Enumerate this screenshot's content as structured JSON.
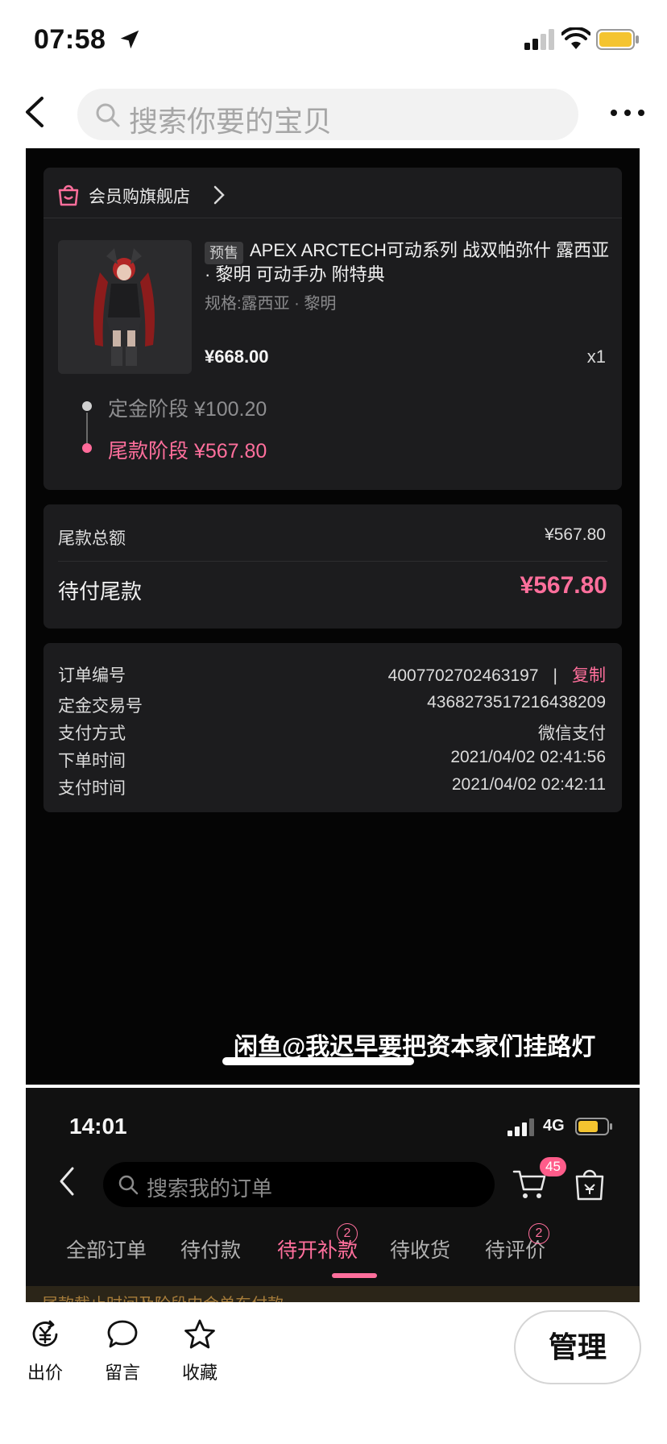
{
  "status_bar": {
    "time": "07:58"
  },
  "search": {
    "placeholder": "搜索你要的宝贝"
  },
  "order_screen": {
    "store": {
      "name": "会员购旗舰店"
    },
    "product": {
      "tag": "预售",
      "title": "APEX ARCTECH可动系列 战双帕弥什 露西亚 · 黎明 可动手办 附特典",
      "spec": "规格:露西亚 · 黎明",
      "price": "¥668.00",
      "qty": "x1"
    },
    "stages": [
      {
        "label": "定金阶段 ¥100.20",
        "active": false
      },
      {
        "label": "尾款阶段 ¥567.80",
        "active": true
      }
    ],
    "summary": {
      "total_label": "尾款总额",
      "total_value": "¥567.80",
      "due_label": "待付尾款",
      "due_value": "¥567.80"
    },
    "info": {
      "order_no_label": "订单编号",
      "order_no": "4007702702463197",
      "copy_label": "复制",
      "deposit_no_label": "定金交易号",
      "deposit_no": "4368273517216438209",
      "pay_method_label": "支付方式",
      "pay_method": "微信支付",
      "order_time_label": "下单时间",
      "order_time": "2021/04/02 02:41:56",
      "pay_time_label": "支付时间",
      "pay_time": "2021/04/02 02:42:11"
    },
    "watermark": "闲鱼@我迟早要把资本家们挂路灯"
  },
  "order_list_screen": {
    "time": "14:01",
    "network": "4G",
    "search_placeholder": "搜索我的订单",
    "cart_badge": "45",
    "tabs": [
      {
        "label": "全部订单",
        "badge": ""
      },
      {
        "label": "待付款",
        "badge": ""
      },
      {
        "label": "待开补款",
        "badge": "2",
        "active": true
      },
      {
        "label": "待收货",
        "badge": ""
      },
      {
        "label": "待评价",
        "badge": "2"
      }
    ],
    "banner": "尾款截止时间及阶段内会单东付款"
  },
  "bottom_bar": {
    "actions": [
      {
        "label": "出价",
        "icon": "yuan-icon"
      },
      {
        "label": "留言",
        "icon": "comment-icon"
      },
      {
        "label": "收藏",
        "icon": "star-icon"
      }
    ],
    "manage_label": "管理"
  },
  "colors": {
    "accent_pink": "#ff6f9c",
    "dark_bg": "#050505",
    "card_bg": "#1c1c1e"
  }
}
